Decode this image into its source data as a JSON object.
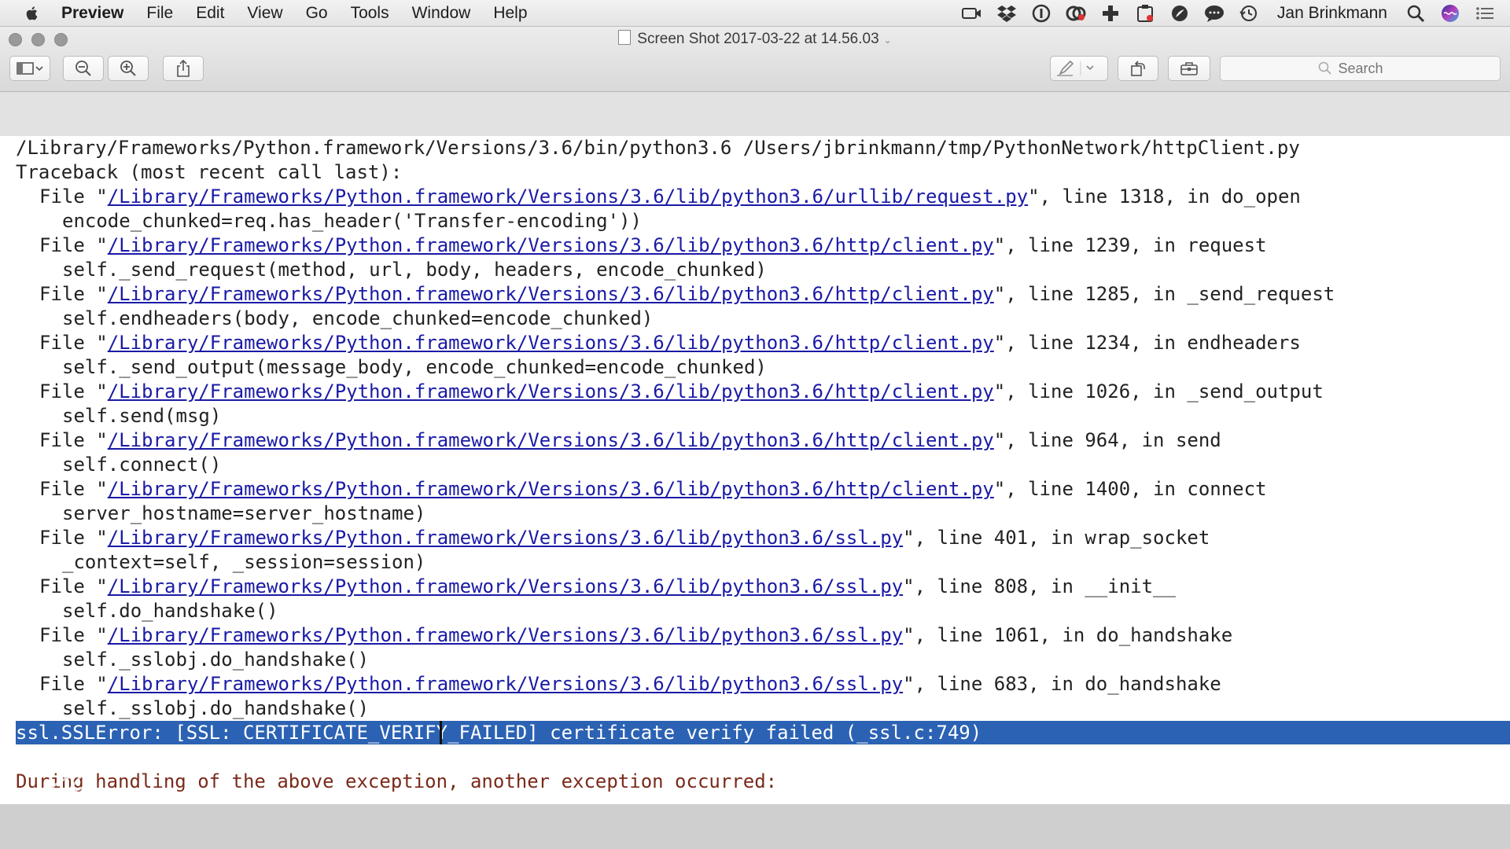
{
  "menubar": {
    "app_name": "Preview",
    "items": [
      "File",
      "Edit",
      "View",
      "Go",
      "Tools",
      "Window",
      "Help"
    ],
    "user_name": "Jan Brinkmann"
  },
  "window": {
    "title": "Screen Shot 2017-03-22 at 14.56.03"
  },
  "toolbar": {
    "search_placeholder": "Search"
  },
  "terminal": {
    "command": "/Library/Frameworks/Python.framework/Versions/3.6/bin/python3.6 /Users/jbrinkmann/tmp/PythonNetwork/httpClient.py",
    "traceback_header": "Traceback (most recent call last):",
    "frames": [
      {
        "path": "/Library/Frameworks/Python.framework/Versions/3.6/lib/python3.6/urllib/request.py",
        "suffix": "\", line 1318, in do_open",
        "code": "encode_chunked=req.has_header('Transfer-encoding'))"
      },
      {
        "path": "/Library/Frameworks/Python.framework/Versions/3.6/lib/python3.6/http/client.py",
        "suffix": "\", line 1239, in request",
        "code": "self._send_request(method, url, body, headers, encode_chunked)"
      },
      {
        "path": "/Library/Frameworks/Python.framework/Versions/3.6/lib/python3.6/http/client.py",
        "suffix": "\", line 1285, in _send_request",
        "code": "self.endheaders(body, encode_chunked=encode_chunked)"
      },
      {
        "path": "/Library/Frameworks/Python.framework/Versions/3.6/lib/python3.6/http/client.py",
        "suffix": "\", line 1234, in endheaders",
        "code": "self._send_output(message_body, encode_chunked=encode_chunked)"
      },
      {
        "path": "/Library/Frameworks/Python.framework/Versions/3.6/lib/python3.6/http/client.py",
        "suffix": "\", line 1026, in _send_output",
        "code": "self.send(msg)"
      },
      {
        "path": "/Library/Frameworks/Python.framework/Versions/3.6/lib/python3.6/http/client.py",
        "suffix": "\", line 964, in send",
        "code": "self.connect()"
      },
      {
        "path": "/Library/Frameworks/Python.framework/Versions/3.6/lib/python3.6/http/client.py",
        "suffix": "\", line 1400, in connect",
        "code": "server_hostname=server_hostname)"
      },
      {
        "path": "/Library/Frameworks/Python.framework/Versions/3.6/lib/python3.6/ssl.py",
        "suffix": "\", line 401, in wrap_socket",
        "code": "_context=self, _session=session)"
      },
      {
        "path": "/Library/Frameworks/Python.framework/Versions/3.6/lib/python3.6/ssl.py",
        "suffix": "\", line 808, in __init__",
        "code": "self.do_handshake()"
      },
      {
        "path": "/Library/Frameworks/Python.framework/Versions/3.6/lib/python3.6/ssl.py",
        "suffix": "\", line 1061, in do_handshake",
        "code": "self._sslobj.do_handshake()"
      },
      {
        "path": "/Library/Frameworks/Python.framework/Versions/3.6/lib/python3.6/ssl.py",
        "suffix": "\", line 683, in do_handshake",
        "code": "self._sslobj.do_handshake()"
      }
    ],
    "frame_prefix": "File \"",
    "error_line": "ssl.SSLError: [SSL: CERTIFICATE_VERIFY_FAILED] certificate verify failed (_ssl.c:749)",
    "handling_line": "During handling of the above exception, another exception occurred:"
  }
}
